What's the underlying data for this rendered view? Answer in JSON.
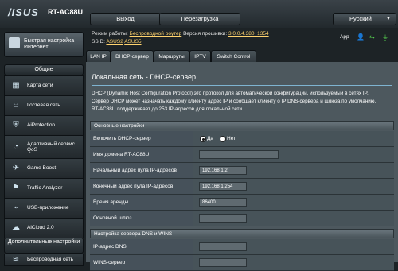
{
  "header": {
    "brand": "/ISUS",
    "model": "RT-AC88U",
    "exit_label": "Выход",
    "reboot_label": "Перезагрузка",
    "language": "Русский"
  },
  "info": {
    "mode_label": "Режим работы:",
    "mode_value": "Беспроводной роутер",
    "firmware_label": "Версия прошивки:",
    "firmware_value": "3.0.0.4.380_1354",
    "ssid_label": "SSID:",
    "ssid_1": "ASUS2",
    "ssid_2": "ASUS5",
    "app_label": "App"
  },
  "sidebar": {
    "quick_setup": "Быстрая настройка Интернет",
    "general_header": "Общие",
    "items": [
      {
        "label": "Карта сети",
        "icon": "network-map-icon"
      },
      {
        "label": "Гостевая сеть",
        "icon": "guest-network-icon"
      },
      {
        "label": "AiProtection",
        "icon": "aiprotection-icon"
      },
      {
        "label": "Адаптивный сервис QoS",
        "icon": "qos-icon"
      },
      {
        "label": "Game Boost",
        "icon": "game-boost-icon"
      },
      {
        "label": "Traffic Analyzer",
        "icon": "traffic-analyzer-icon"
      },
      {
        "label": "USB-приложение",
        "icon": "usb-icon"
      },
      {
        "label": "AiCloud 2.0",
        "icon": "aicloud-icon"
      }
    ],
    "advanced_header": "Дополнительные настройки",
    "advanced_first": "Беспроводная сеть"
  },
  "tabs": [
    "LAN IP",
    "DHCP-сервер",
    "Маршруты",
    "IPTV",
    "Switch Control"
  ],
  "main": {
    "title": "Локальная сеть - DHCP-сервер",
    "desc_1": "DHCP (Dynamic Host Configuration Protocol) это протокол для автоматической конфигурации, используемый в сетях IP.",
    "desc_2": "Сервер DHCP может назначать каждому клиенту адрес IP и сообщает клиенту о IP DNS-сервера и шлюза по умолчанию.",
    "desc_3": "RT-AC88U поддерживает до 253 IP-адресов для локальной сети."
  },
  "basic": {
    "header": "Основные настройки",
    "enable_label": "Включить DHCP-сервер",
    "yes": "Да",
    "no": "Нет",
    "domain_label": "Имя домена RT-AC88U",
    "domain_value": "",
    "start_label": "Начальный адрес пула IP-адресов",
    "start_value": "192.168.1.2",
    "end_label": "Конечный адрес пула IP-адресов",
    "end_value": "192.168.1.254",
    "lease_label": "Время аренды",
    "lease_value": "86400",
    "gateway_label": "Основной шлюз",
    "gateway_value": ""
  },
  "dns": {
    "header": "Настройка сервера DNS и WINS",
    "dns_label": "IP-адрес DNS",
    "dns_value": "",
    "wins_label": "WINS-сервер",
    "wins_value": ""
  }
}
